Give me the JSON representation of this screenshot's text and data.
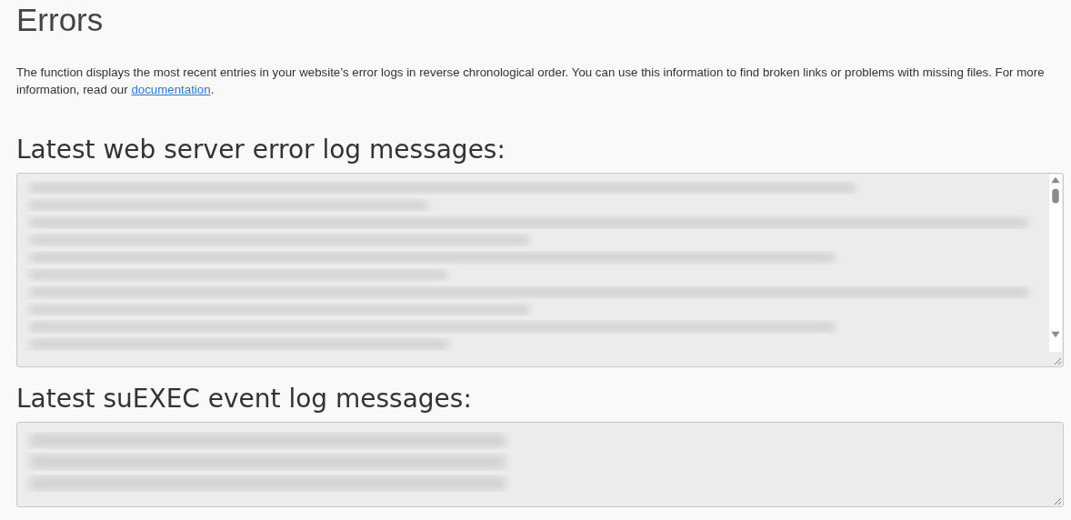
{
  "page": {
    "title": "Errors"
  },
  "description": {
    "text": "The function displays the most recent entries in your website’s error logs in reverse chronological order. You can use this information to find broken links or problems with missing files. For more information, read our",
    "link": "documentation",
    "after": "."
  },
  "sections": [
    {
      "heading": "Latest web server error log messages:",
      "kind": "scrolling"
    },
    {
      "heading": "Latest suEXEC event log messages:",
      "kind": "plain"
    }
  ]
}
